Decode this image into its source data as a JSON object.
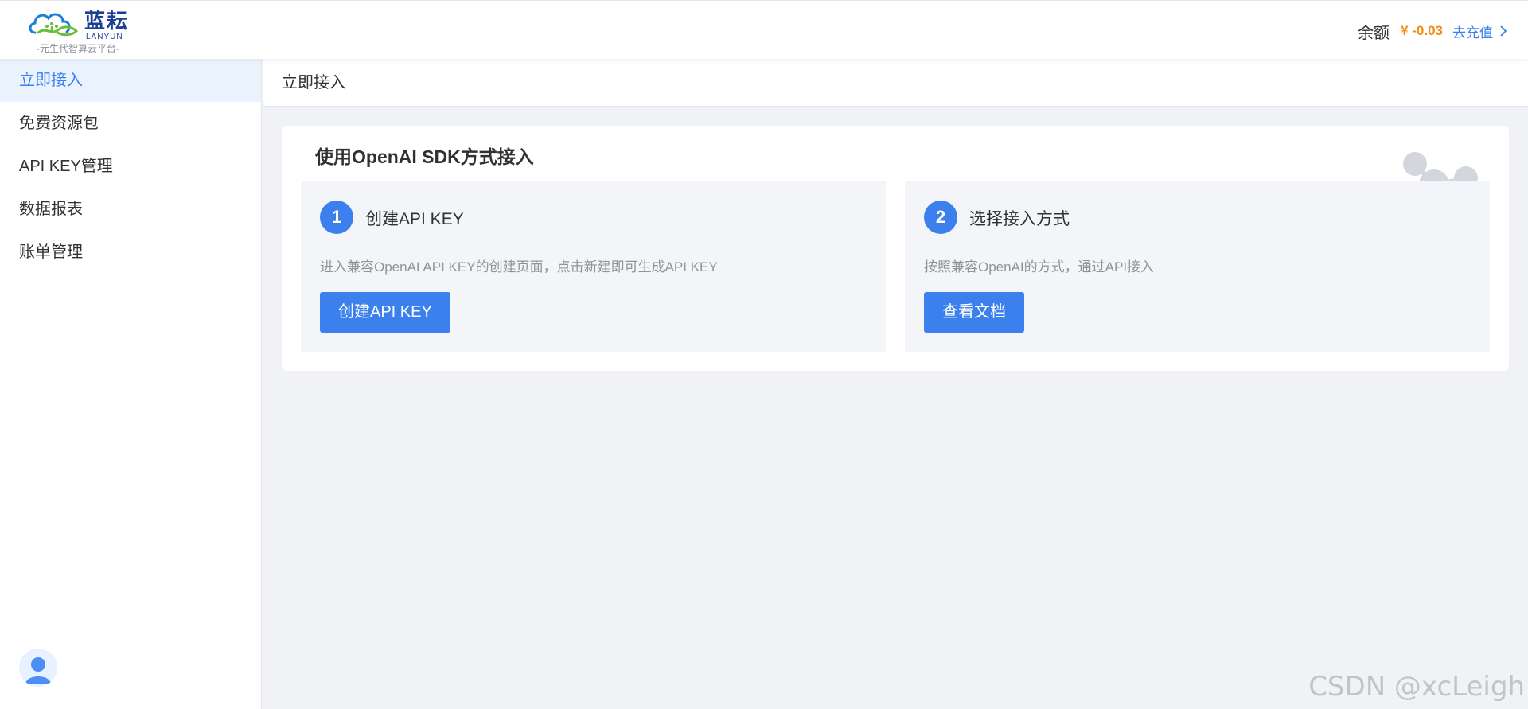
{
  "header": {
    "logo_cn": "蓝耘",
    "logo_en": "LANYUN",
    "logo_slogan": "-元生代智算云平台-",
    "balance_label": "余额",
    "balance_amount": "¥ -0.03",
    "recharge_label": "去充值"
  },
  "sidebar": {
    "items": [
      {
        "label": "立即接入"
      },
      {
        "label": "免费资源包"
      },
      {
        "label": "API KEY管理"
      },
      {
        "label": "数据报表"
      },
      {
        "label": "账单管理"
      }
    ],
    "avatar_icon": "user-avatar-icon"
  },
  "main": {
    "breadcrumb": "立即接入",
    "card_title": "使用OpenAI SDK方式接入",
    "decor_icon": "network-nodes-icon",
    "steps": [
      {
        "number": "1",
        "title": "创建API KEY",
        "description": "进入兼容OpenAI API KEY的创建页面，点击新建即可生成API KEY",
        "button_label": "创建API KEY"
      },
      {
        "number": "2",
        "title": "选择接入方式",
        "description": "按照兼容OpenAI的方式，通过API接入",
        "button_label": "查看文档"
      }
    ]
  },
  "watermark": "CSDN @xcLeigh",
  "colors": {
    "accent": "#3c80ee",
    "balance": "#f08c12",
    "active_bg": "#eaf2fe",
    "panel_bg": "#f3f5f9",
    "page_bg": "#f0f2f5"
  }
}
